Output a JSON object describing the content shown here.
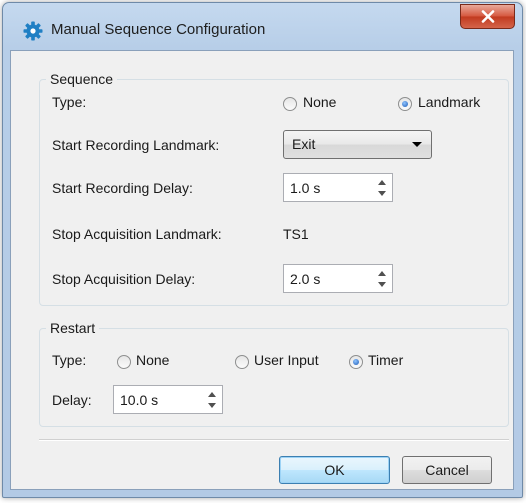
{
  "window": {
    "title": "Manual Sequence Configuration"
  },
  "sequence": {
    "legend": "Sequence",
    "type_label": "Type:",
    "type_options": [
      {
        "label": "None",
        "checked": false
      },
      {
        "label": "Landmark",
        "checked": true
      }
    ],
    "start_landmark_label": "Start Recording Landmark:",
    "start_landmark_value": "Exit",
    "start_delay_label": "Start Recording Delay:",
    "start_delay_value": "1.0 s",
    "stop_landmark_label": "Stop Acquisition Landmark:",
    "stop_landmark_value": "TS1",
    "stop_delay_label": "Stop Acquisition Delay:",
    "stop_delay_value": "2.0 s"
  },
  "restart": {
    "legend": "Restart",
    "type_label": "Type:",
    "type_options": [
      {
        "label": "None",
        "checked": false
      },
      {
        "label": "User Input",
        "checked": false
      },
      {
        "label": "Timer",
        "checked": true
      }
    ],
    "delay_label": "Delay:",
    "delay_value": "10.0 s"
  },
  "buttons": {
    "ok": "OK",
    "cancel": "Cancel"
  },
  "colors": {
    "accent": "#1c5ab5",
    "close": "#c13a1f",
    "gear": "#1f7fc4"
  }
}
